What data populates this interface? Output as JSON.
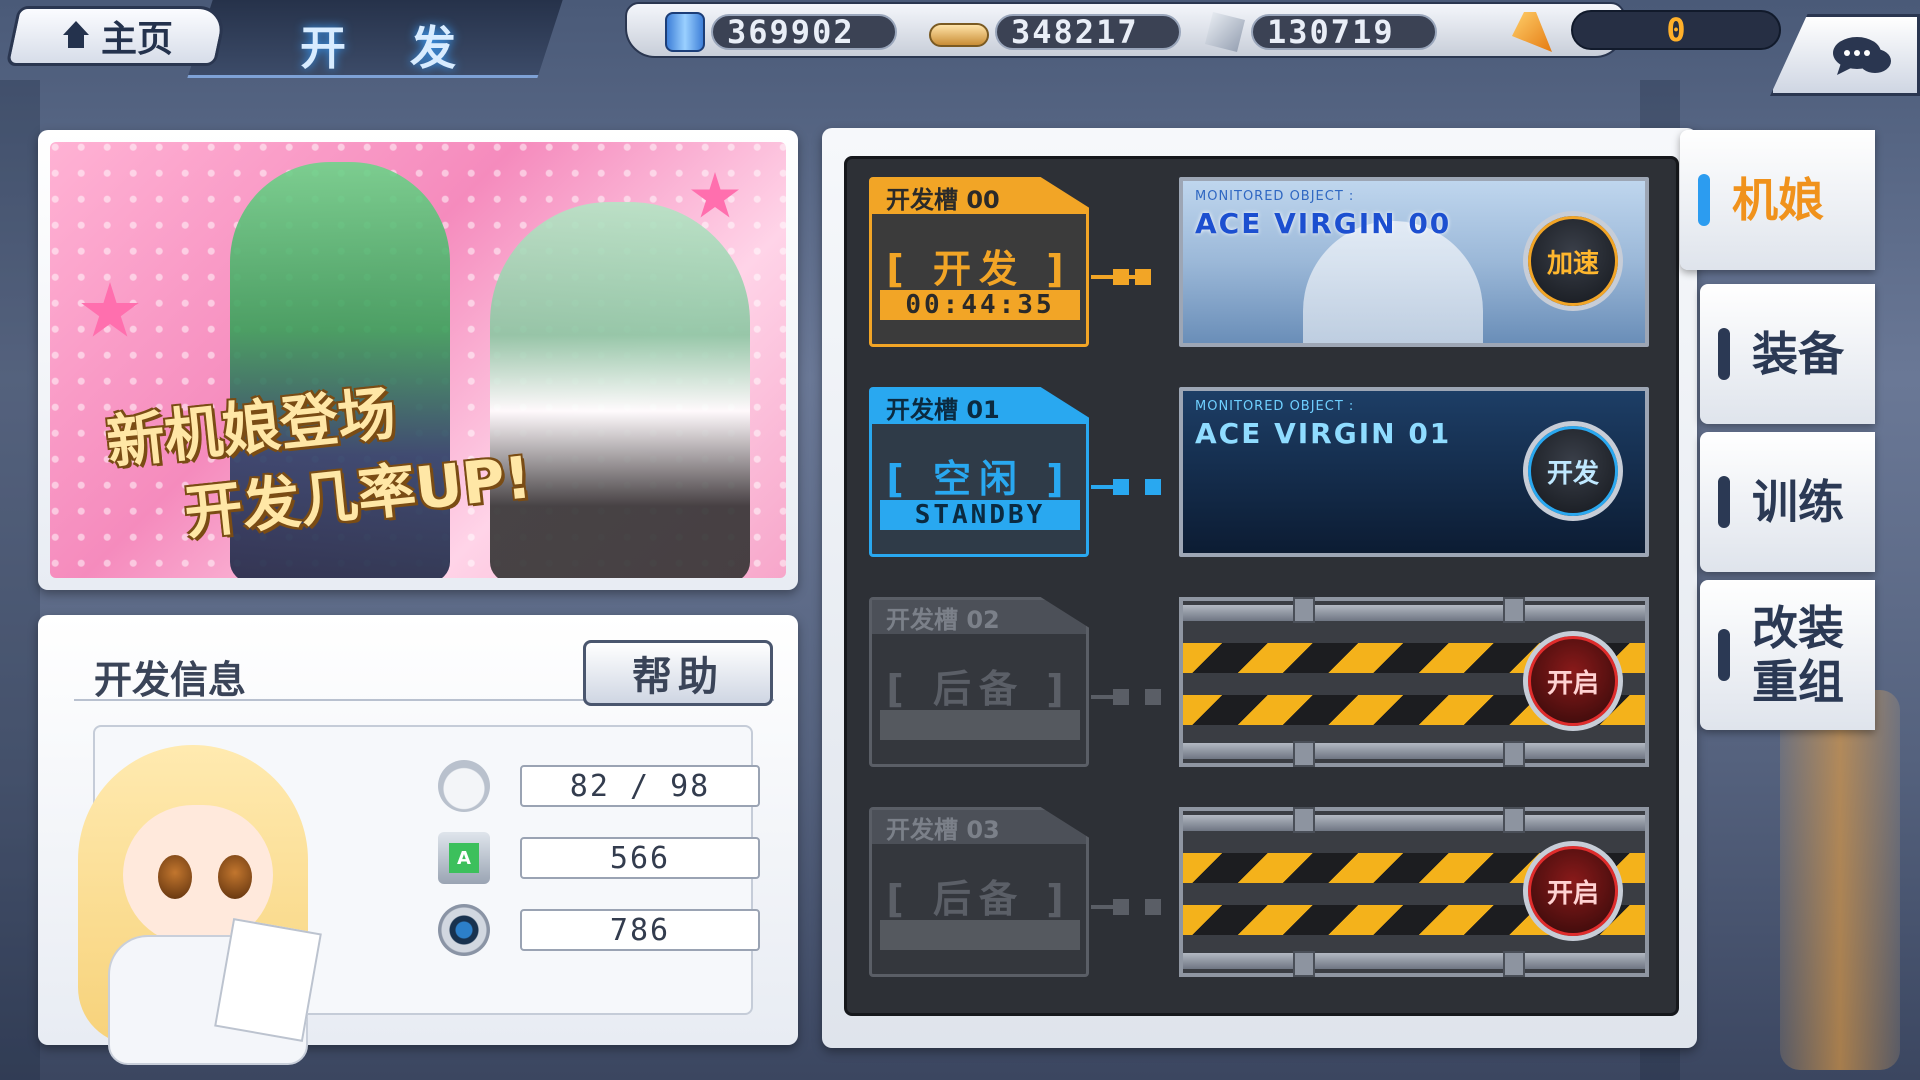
{
  "header": {
    "home_label": "主页",
    "title": "开 发"
  },
  "resources": {
    "fuel": "369902",
    "ammo": "348217",
    "steel": "130719",
    "diamond": "0"
  },
  "banner": {
    "line1": "新机娘登场",
    "line2": "开发几率UP!"
  },
  "info": {
    "title": "开发信息",
    "help_label": "帮助",
    "stats": {
      "count": "82 / 98",
      "chips": "566",
      "cores": "786"
    }
  },
  "slots": [
    {
      "title": "开发槽 00",
      "status": "[ 开发 ]",
      "footer": "00:44:35",
      "monitor_label": "MONITORED OBJECT :",
      "monitor_name": "ACE VIRGIN   00",
      "button": "加速"
    },
    {
      "title": "开发槽 01",
      "status": "[ 空闲 ]",
      "footer": "STANDBY",
      "monitor_label": "MONITORED OBJECT :",
      "monitor_name": "ACE VIRGIN   01",
      "button": "开发"
    },
    {
      "title": "开发槽 02",
      "status": "[ 后备 ]",
      "button": "开启"
    },
    {
      "title": "开发槽 03",
      "status": "[ 后备 ]",
      "button": "开启"
    }
  ],
  "side_tabs": [
    {
      "label": "机娘"
    },
    {
      "label": "装备"
    },
    {
      "label": "训练"
    },
    {
      "label": "改装\n重组"
    }
  ],
  "colors": {
    "active_orange": "#f2a526",
    "idle_blue": "#29a8f0",
    "locked_gray": "#5a5e66",
    "tab_active": "#f0921c"
  },
  "icons": {
    "home": "house-icon",
    "fuel": "fuel-canister-icon",
    "ammo": "ammo-icon",
    "steel": "steel-icon",
    "gold": "gold-feather-icon",
    "chat": "chat-bubble-icon"
  }
}
